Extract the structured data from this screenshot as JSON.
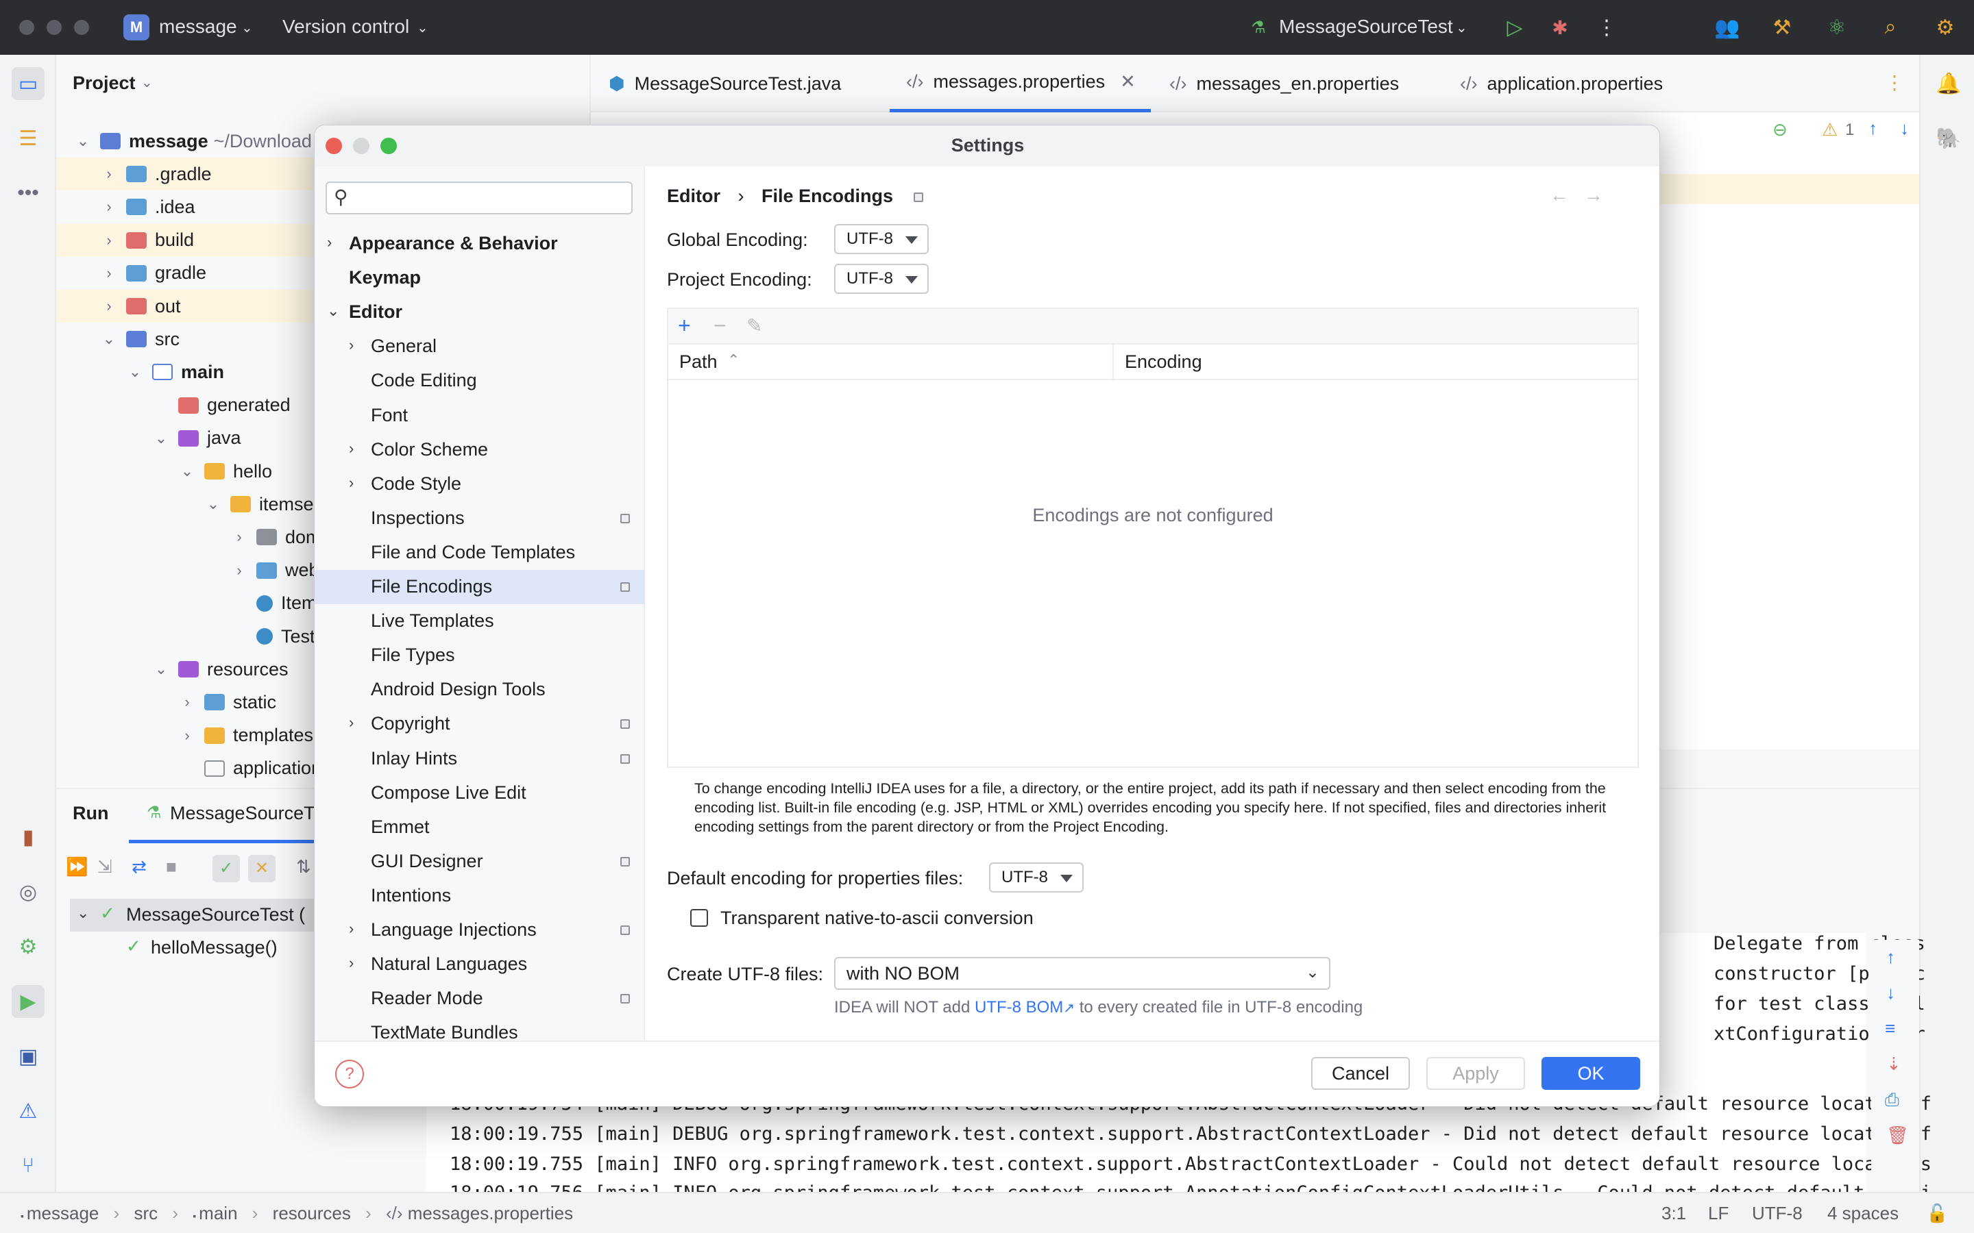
{
  "titlebar": {
    "project_letter": "M",
    "project_name": "message",
    "vcs_label": "Version control",
    "run_config": "MessageSourceTest"
  },
  "project_panel": {
    "title": "Project",
    "tree": [
      {
        "label": "message",
        "suffix": "~/Download",
        "depth": 0,
        "expanded": true
      },
      {
        "label": ".gradle",
        "depth": 1,
        "expanded": false
      },
      {
        "label": ".idea",
        "depth": 1,
        "expanded": false
      },
      {
        "label": "build",
        "depth": 1,
        "expanded": false
      },
      {
        "label": "gradle",
        "depth": 1,
        "expanded": false
      },
      {
        "label": "out",
        "depth": 1,
        "expanded": false
      },
      {
        "label": "src",
        "depth": 1,
        "expanded": true
      },
      {
        "label": "main",
        "depth": 2,
        "expanded": true
      },
      {
        "label": "generated",
        "depth": 3
      },
      {
        "label": "java",
        "depth": 3,
        "expanded": true
      },
      {
        "label": "hello",
        "depth": 4,
        "expanded": true
      },
      {
        "label": "itemser",
        "depth": 5,
        "expanded": true
      },
      {
        "label": "doma",
        "depth": 6,
        "expanded": false
      },
      {
        "label": "web",
        "depth": 6,
        "expanded": false
      },
      {
        "label": "Item",
        "depth": 6
      },
      {
        "label": "Testl",
        "depth": 6
      },
      {
        "label": "resources",
        "depth": 3,
        "expanded": true
      },
      {
        "label": "static",
        "depth": 4,
        "expanded": false
      },
      {
        "label": "templates",
        "depth": 4,
        "expanded": false
      },
      {
        "label": "application",
        "depth": 4
      }
    ]
  },
  "editor_tabs": [
    {
      "label": "MessageSourceTest.java",
      "active": false
    },
    {
      "label": "messages.properties",
      "active": true
    },
    {
      "label": "messages_en.properties",
      "active": false
    },
    {
      "label": "application.properties",
      "active": false
    }
  ],
  "editor": {
    "warnings_count": "1"
  },
  "run_panel": {
    "title": "Run",
    "config": "MessageSourceT",
    "tests": [
      {
        "label": "MessageSourceTest (",
        "depth": 0
      },
      {
        "label": "helloMessage()",
        "depth": 1
      }
    ],
    "console_fragments": [
      "Delegate from class",
      "constructor [public",
      " for test class [hel",
      "xtConfiguration nor"
    ],
    "console_lines": [
      "18:00:19.754 [main] DEBUG org.springframework.test.context.support.AbstractContextLoader - Did not detect default resource location f",
      "18:00:19.755 [main] DEBUG org.springframework.test.context.support.AbstractContextLoader - Did not detect default resource location f",
      "18:00:19.755 [main] INFO org.springframework.test.context.support.AbstractContextLoader - Could not detect default resource locations",
      "18:00:19.756 [main] INFO org.springframework.test.context.support.AnnotationConfigContextLoaderUtils - Could not detect default confi"
    ]
  },
  "statusbar": {
    "breadcrumbs": [
      "message",
      "src",
      "main",
      "resources",
      "messages.properties"
    ],
    "position": "3:1",
    "line_sep": "LF",
    "encoding": "UTF-8",
    "indent": "4 spaces"
  },
  "dialog": {
    "title": "Settings",
    "search_placeholder": "",
    "nav": [
      {
        "label": "Appearance & Behavior",
        "level": 0,
        "chevron": "right",
        "bold": true
      },
      {
        "label": "Keymap",
        "level": 0,
        "bold": true
      },
      {
        "label": "Editor",
        "level": 0,
        "chevron": "down",
        "bold": true
      },
      {
        "label": "General",
        "level": 1,
        "chevron": "right"
      },
      {
        "label": "Code Editing",
        "level": 1
      },
      {
        "label": "Font",
        "level": 1
      },
      {
        "label": "Color Scheme",
        "level": 1,
        "chevron": "right"
      },
      {
        "label": "Code Style",
        "level": 1,
        "chevron": "right"
      },
      {
        "label": "Inspections",
        "level": 1,
        "pin": true
      },
      {
        "label": "File and Code Templates",
        "level": 1
      },
      {
        "label": "File Encodings",
        "level": 1,
        "pin": true,
        "selected": true
      },
      {
        "label": "Live Templates",
        "level": 1
      },
      {
        "label": "File Types",
        "level": 1
      },
      {
        "label": "Android Design Tools",
        "level": 1
      },
      {
        "label": "Copyright",
        "level": 1,
        "chevron": "right",
        "pin": true
      },
      {
        "label": "Inlay Hints",
        "level": 1,
        "pin": true
      },
      {
        "label": "Compose Live Edit",
        "level": 1
      },
      {
        "label": "Emmet",
        "level": 1
      },
      {
        "label": "GUI Designer",
        "level": 1,
        "pin": true
      },
      {
        "label": "Intentions",
        "level": 1
      },
      {
        "label": "Language Injections",
        "level": 1,
        "chevron": "right",
        "pin": true
      },
      {
        "label": "Natural Languages",
        "level": 1,
        "chevron": "right"
      },
      {
        "label": "Reader Mode",
        "level": 1,
        "pin": true
      },
      {
        "label": "TextMate Bundles",
        "level": 1
      }
    ],
    "breadcrumb_parent": "Editor",
    "breadcrumb_current": "File Encodings",
    "global_encoding_label": "Global Encoding:",
    "global_encoding_value": "UTF-8",
    "project_encoding_label": "Project Encoding:",
    "project_encoding_value": "UTF-8",
    "table": {
      "col_path": "Path",
      "col_encoding": "Encoding",
      "empty_text": "Encodings are not configured"
    },
    "help_text": "To change encoding IntelliJ IDEA uses for a file, a directory, or the entire project, add its path if necessary and then select encoding from the encoding list. Built-in file encoding (e.g. JSP, HTML or XML) overrides encoding you specify here. If not specified, files and directories inherit encoding settings from the parent directory or from the Project Encoding.",
    "default_props_label": "Default encoding for properties files:",
    "default_props_value": "UTF-8",
    "transparent_label": "Transparent native-to-ascii conversion",
    "transparent_checked": false,
    "create_utf8_label": "Create UTF-8 files:",
    "create_utf8_value": "with NO BOM",
    "bom_note_prefix": "IDEA will NOT add ",
    "bom_note_link": "UTF-8 BOM",
    "bom_note_suffix": " to every created file in UTF-8 encoding",
    "cancel_label": "Cancel",
    "apply_label": "Apply",
    "ok_label": "OK"
  },
  "colors": {
    "accent": "#3574f0",
    "selection": "#dfe6f8",
    "titlebar": "#2b2d30"
  }
}
